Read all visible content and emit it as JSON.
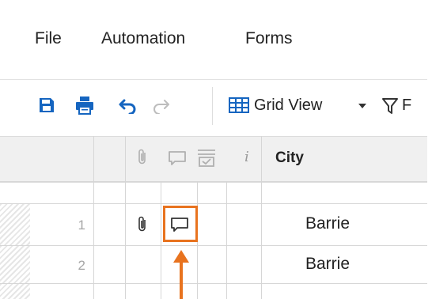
{
  "menu": {
    "items": [
      "File",
      "Automation",
      "Forms"
    ]
  },
  "toolbar": {
    "save_icon": "save-icon",
    "print_icon": "print-icon",
    "undo_icon": "undo-icon",
    "redo_icon": "redo-icon",
    "grid_view_label": "Grid View",
    "filter_label": "F",
    "accent": "#1565c0"
  },
  "grid": {
    "header": {
      "info_label": "i",
      "city_label": "City"
    },
    "rows": [
      {
        "number": "1",
        "city": "Barrie"
      },
      {
        "number": "2",
        "city": "Barrie"
      }
    ]
  },
  "annotation": {
    "color": "#e8731f"
  }
}
